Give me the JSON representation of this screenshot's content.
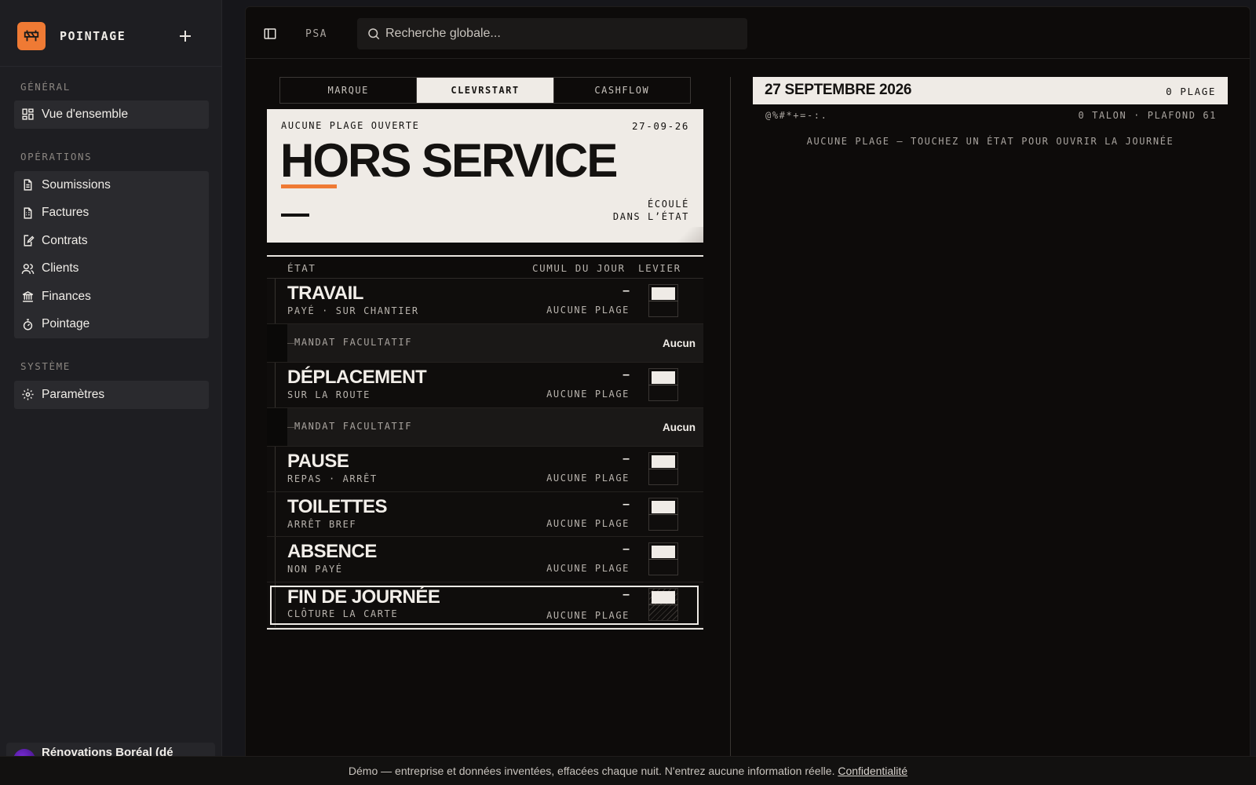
{
  "sidebar": {
    "brand": "POINTAGE",
    "sections": [
      {
        "title": "GÉNÉRAL",
        "items": [
          {
            "label": "Vue d'ensemble",
            "icon": "dashboard-icon"
          }
        ]
      },
      {
        "title": "OPÉRATIONS",
        "items": [
          {
            "label": "Soumissions",
            "icon": "document-icon"
          },
          {
            "label": "Factures",
            "icon": "invoice-icon"
          },
          {
            "label": "Contrats",
            "icon": "contract-edit-icon"
          },
          {
            "label": "Clients",
            "icon": "users-icon"
          },
          {
            "label": "Finances",
            "icon": "bank-icon"
          },
          {
            "label": "Pointage",
            "icon": "stopwatch-icon"
          }
        ]
      },
      {
        "title": "SYSTÈME",
        "items": [
          {
            "label": "Paramètres",
            "icon": "gear-icon"
          }
        ]
      }
    ],
    "org_name": "Rénovations Boréal (dé"
  },
  "topbar": {
    "crumb": "PSA",
    "search_placeholder": "Recherche globale..."
  },
  "tabs": [
    "MARQUE",
    "CLEVRSTART",
    "CASHFLOW"
  ],
  "active_tab": "CLEVRSTART",
  "status_card": {
    "status": "AUCUNE PLAGE OUVERTE",
    "date": "27-09-26",
    "title": "HORS SERVICE",
    "elapsed_label_1": "ÉCOULÉ",
    "elapsed_label_2": "DANS L’ÉTAT"
  },
  "table": {
    "headers": {
      "state": "ÉTAT",
      "cumul": "CUMUL DU JOUR",
      "lever": "LEVIER"
    },
    "rows": [
      {
        "name": "TRAVAIL",
        "sub": "PAYÉ · SUR CHANTIER",
        "cumul": "–",
        "plage": "AUCUNE PLAGE",
        "mandat_label": "MANDAT FACULTATIF",
        "mandat_value": "Aucun"
      },
      {
        "name": "DÉPLACEMENT",
        "sub": "SUR LA ROUTE",
        "cumul": "–",
        "plage": "AUCUNE PLAGE",
        "mandat_label": "MANDAT FACULTATIF",
        "mandat_value": "Aucun"
      },
      {
        "name": "PAUSE",
        "sub": "REPAS · ARRÊT",
        "cumul": "–",
        "plage": "AUCUNE PLAGE"
      },
      {
        "name": "TOILETTES",
        "sub": "ARRÊT BREF",
        "cumul": "–",
        "plage": "AUCUNE PLAGE"
      },
      {
        "name": "ABSENCE",
        "sub": "NON PAYÉ",
        "cumul": "–",
        "plage": "AUCUNE PLAGE"
      },
      {
        "name": "FIN DE JOURNÉE",
        "sub": "CLÔTURE LA CARTE",
        "cumul": "–",
        "plage": "AUCUNE PLAGE"
      }
    ]
  },
  "day_panel": {
    "title": "27 SEPTEMBRE 2026",
    "count": "0 PLAGE",
    "ramp": "@%#*+=-:.",
    "talon": "0 TALON · PLAFOND 61",
    "empty": "AUCUNE PLAGE — TOUCHEZ UN ÉTAT POUR OUVRIR LA JOURNÉE"
  },
  "footer": {
    "text": "Démo — entreprise et données inventées, effacées chaque nuit. N'entrez aucune information réelle.",
    "link": "Confidentialité"
  },
  "colors": {
    "accent": "#ef7a34",
    "paper": "#efebe6",
    "background": "#0d0b0a"
  }
}
